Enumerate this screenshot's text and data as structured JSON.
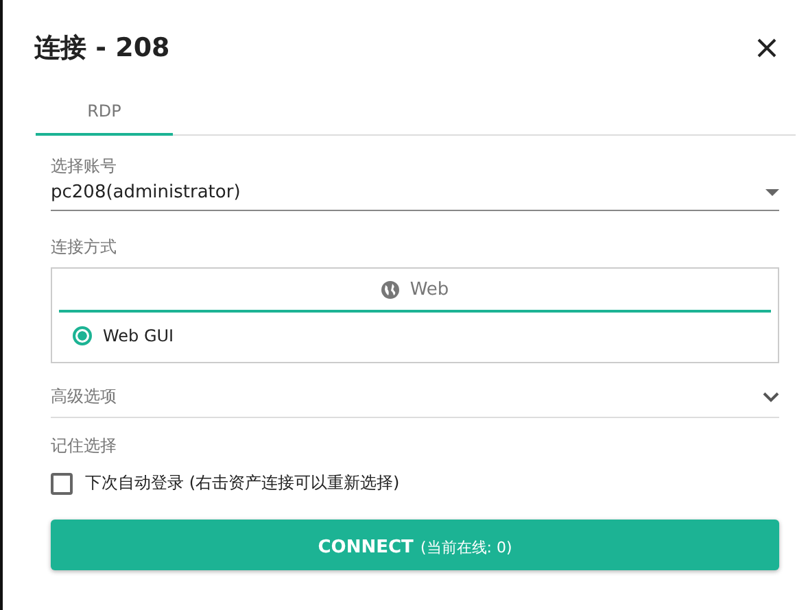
{
  "dialog": {
    "title": "连接 - 208"
  },
  "tabs": [
    {
      "label": "RDP",
      "selected": true
    }
  ],
  "account": {
    "label": "选择账号",
    "value": "pc208(administrator)"
  },
  "method": {
    "label": "连接方式",
    "group": "Web",
    "options": [
      {
        "label": "Web GUI",
        "selected": true
      }
    ]
  },
  "advanced": {
    "label": "高级选项",
    "expanded": false
  },
  "remember": {
    "label": "记住选择",
    "checkbox": {
      "label": "下次自动登录 (右击资产连接可以重新选择)",
      "checked": false
    }
  },
  "connect_button": {
    "label": "CONNECT",
    "note": "(当前在线: 0)"
  }
}
